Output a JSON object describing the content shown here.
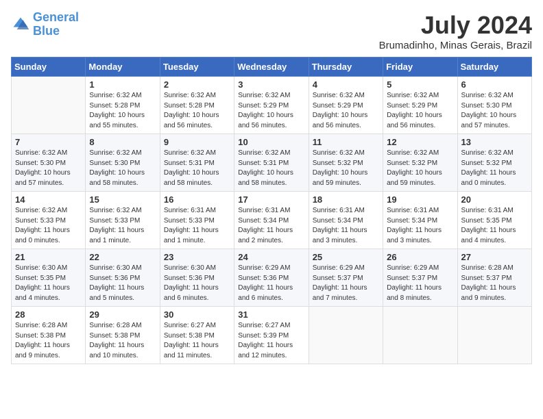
{
  "header": {
    "logo_line1": "General",
    "logo_line2": "Blue",
    "month": "July 2024",
    "location": "Brumadinho, Minas Gerais, Brazil"
  },
  "weekdays": [
    "Sunday",
    "Monday",
    "Tuesday",
    "Wednesday",
    "Thursday",
    "Friday",
    "Saturday"
  ],
  "weeks": [
    [
      {
        "num": "",
        "info": ""
      },
      {
        "num": "1",
        "info": "Sunrise: 6:32 AM\nSunset: 5:28 PM\nDaylight: 10 hours\nand 55 minutes."
      },
      {
        "num": "2",
        "info": "Sunrise: 6:32 AM\nSunset: 5:28 PM\nDaylight: 10 hours\nand 56 minutes."
      },
      {
        "num": "3",
        "info": "Sunrise: 6:32 AM\nSunset: 5:29 PM\nDaylight: 10 hours\nand 56 minutes."
      },
      {
        "num": "4",
        "info": "Sunrise: 6:32 AM\nSunset: 5:29 PM\nDaylight: 10 hours\nand 56 minutes."
      },
      {
        "num": "5",
        "info": "Sunrise: 6:32 AM\nSunset: 5:29 PM\nDaylight: 10 hours\nand 56 minutes."
      },
      {
        "num": "6",
        "info": "Sunrise: 6:32 AM\nSunset: 5:30 PM\nDaylight: 10 hours\nand 57 minutes."
      }
    ],
    [
      {
        "num": "7",
        "info": "Sunrise: 6:32 AM\nSunset: 5:30 PM\nDaylight: 10 hours\nand 57 minutes."
      },
      {
        "num": "8",
        "info": "Sunrise: 6:32 AM\nSunset: 5:30 PM\nDaylight: 10 hours\nand 58 minutes."
      },
      {
        "num": "9",
        "info": "Sunrise: 6:32 AM\nSunset: 5:31 PM\nDaylight: 10 hours\nand 58 minutes."
      },
      {
        "num": "10",
        "info": "Sunrise: 6:32 AM\nSunset: 5:31 PM\nDaylight: 10 hours\nand 58 minutes."
      },
      {
        "num": "11",
        "info": "Sunrise: 6:32 AM\nSunset: 5:32 PM\nDaylight: 10 hours\nand 59 minutes."
      },
      {
        "num": "12",
        "info": "Sunrise: 6:32 AM\nSunset: 5:32 PM\nDaylight: 10 hours\nand 59 minutes."
      },
      {
        "num": "13",
        "info": "Sunrise: 6:32 AM\nSunset: 5:32 PM\nDaylight: 11 hours\nand 0 minutes."
      }
    ],
    [
      {
        "num": "14",
        "info": "Sunrise: 6:32 AM\nSunset: 5:33 PM\nDaylight: 11 hours\nand 0 minutes."
      },
      {
        "num": "15",
        "info": "Sunrise: 6:32 AM\nSunset: 5:33 PM\nDaylight: 11 hours\nand 1 minute."
      },
      {
        "num": "16",
        "info": "Sunrise: 6:31 AM\nSunset: 5:33 PM\nDaylight: 11 hours\nand 1 minute."
      },
      {
        "num": "17",
        "info": "Sunrise: 6:31 AM\nSunset: 5:34 PM\nDaylight: 11 hours\nand 2 minutes."
      },
      {
        "num": "18",
        "info": "Sunrise: 6:31 AM\nSunset: 5:34 PM\nDaylight: 11 hours\nand 3 minutes."
      },
      {
        "num": "19",
        "info": "Sunrise: 6:31 AM\nSunset: 5:34 PM\nDaylight: 11 hours\nand 3 minutes."
      },
      {
        "num": "20",
        "info": "Sunrise: 6:31 AM\nSunset: 5:35 PM\nDaylight: 11 hours\nand 4 minutes."
      }
    ],
    [
      {
        "num": "21",
        "info": "Sunrise: 6:30 AM\nSunset: 5:35 PM\nDaylight: 11 hours\nand 4 minutes."
      },
      {
        "num": "22",
        "info": "Sunrise: 6:30 AM\nSunset: 5:36 PM\nDaylight: 11 hours\nand 5 minutes."
      },
      {
        "num": "23",
        "info": "Sunrise: 6:30 AM\nSunset: 5:36 PM\nDaylight: 11 hours\nand 6 minutes."
      },
      {
        "num": "24",
        "info": "Sunrise: 6:29 AM\nSunset: 5:36 PM\nDaylight: 11 hours\nand 6 minutes."
      },
      {
        "num": "25",
        "info": "Sunrise: 6:29 AM\nSunset: 5:37 PM\nDaylight: 11 hours\nand 7 minutes."
      },
      {
        "num": "26",
        "info": "Sunrise: 6:29 AM\nSunset: 5:37 PM\nDaylight: 11 hours\nand 8 minutes."
      },
      {
        "num": "27",
        "info": "Sunrise: 6:28 AM\nSunset: 5:37 PM\nDaylight: 11 hours\nand 9 minutes."
      }
    ],
    [
      {
        "num": "28",
        "info": "Sunrise: 6:28 AM\nSunset: 5:38 PM\nDaylight: 11 hours\nand 9 minutes."
      },
      {
        "num": "29",
        "info": "Sunrise: 6:28 AM\nSunset: 5:38 PM\nDaylight: 11 hours\nand 10 minutes."
      },
      {
        "num": "30",
        "info": "Sunrise: 6:27 AM\nSunset: 5:38 PM\nDaylight: 11 hours\nand 11 minutes."
      },
      {
        "num": "31",
        "info": "Sunrise: 6:27 AM\nSunset: 5:39 PM\nDaylight: 11 hours\nand 12 minutes."
      },
      {
        "num": "",
        "info": ""
      },
      {
        "num": "",
        "info": ""
      },
      {
        "num": "",
        "info": ""
      }
    ]
  ]
}
